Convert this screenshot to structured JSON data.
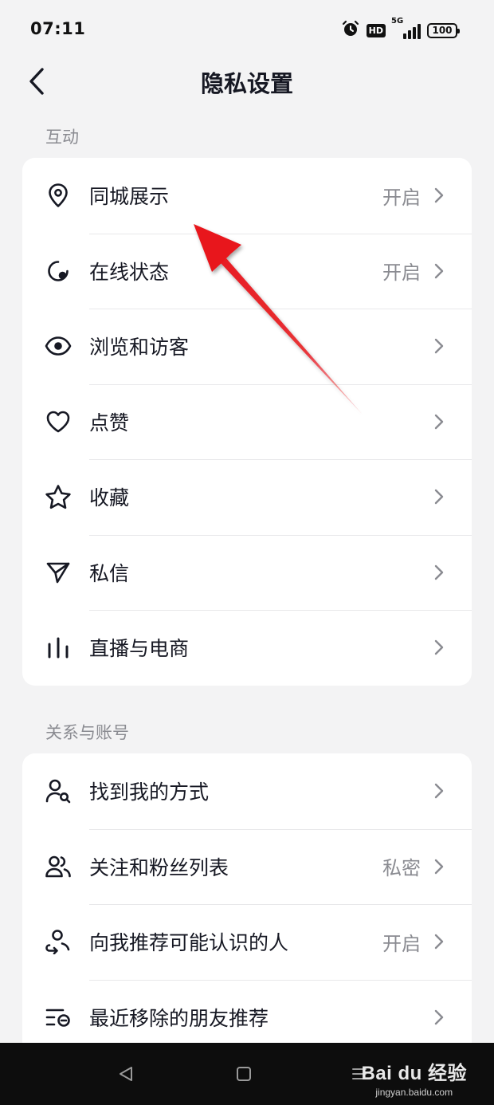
{
  "status_bar": {
    "time": "07:11",
    "hd_label": "HD",
    "network_label": "5G",
    "battery_level": "100"
  },
  "header": {
    "title": "隐私设置"
  },
  "sections": {
    "interaction": {
      "title": "互动",
      "items": [
        {
          "label": "同城展示",
          "value": "开启",
          "icon": "location-pin-icon"
        },
        {
          "label": "在线状态",
          "value": "开启",
          "icon": "online-status-icon"
        },
        {
          "label": "浏览和访客",
          "value": "",
          "icon": "eye-icon"
        },
        {
          "label": "点赞",
          "value": "",
          "icon": "heart-icon"
        },
        {
          "label": "收藏",
          "value": "",
          "icon": "star-icon"
        },
        {
          "label": "私信",
          "value": "",
          "icon": "send-icon"
        },
        {
          "label": "直播与电商",
          "value": "",
          "icon": "bars-icon"
        }
      ]
    },
    "relations": {
      "title": "关系与账号",
      "items": [
        {
          "label": "找到我的方式",
          "value": "",
          "icon": "user-search-icon"
        },
        {
          "label": "关注和粉丝列表",
          "value": "私密",
          "icon": "users-icon"
        },
        {
          "label": "向我推荐可能认识的人",
          "value": "开启",
          "icon": "recommend-user-icon"
        },
        {
          "label": "最近移除的朋友推荐",
          "value": "",
          "icon": "removed-list-icon"
        }
      ]
    }
  },
  "colors": {
    "annotation_arrow": "#e8141b",
    "background": "#f3f3f4",
    "primary_text": "#161823",
    "secondary_text": "#8a8b91"
  },
  "watermark": {
    "brand": "Bai du 经验",
    "url": "jingyan.baidu.com"
  }
}
